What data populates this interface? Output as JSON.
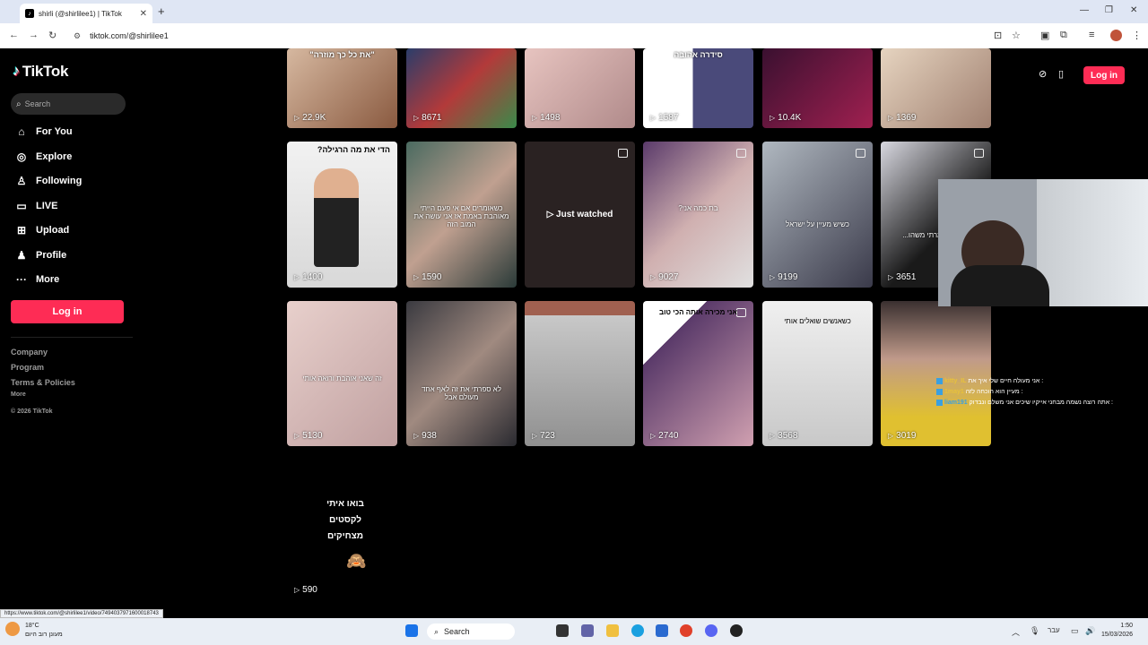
{
  "browser": {
    "tab_title": "shirli (@shirlilee1) | TikTok",
    "tab_close": "✕",
    "new_tab": "+",
    "url": "tiktok.com/@shirlilee1"
  },
  "sidebar": {
    "logo": "TikTok",
    "search_placeholder": "Search",
    "nav": [
      {
        "label": "For You",
        "icon": "home-icon"
      },
      {
        "label": "Explore",
        "icon": "compass-icon"
      },
      {
        "label": "Following",
        "icon": "person-icon"
      },
      {
        "label": "LIVE",
        "icon": "live-icon"
      },
      {
        "label": "Upload",
        "icon": "plus-square-icon"
      },
      {
        "label": "Profile",
        "icon": "profile-icon"
      },
      {
        "label": "More",
        "icon": "more-icon"
      }
    ],
    "login_label": "Log in",
    "footer": {
      "company": "Company",
      "program": "Program",
      "terms": "Terms & Policies",
      "more": "More",
      "copyright": "© 2026 TikTok"
    }
  },
  "header": {
    "login_label": "Log in"
  },
  "videos": {
    "row1": [
      {
        "views": "22.9K",
        "caption": "\"את כל כך מוזרה\""
      },
      {
        "views": "8671",
        "caption": ""
      },
      {
        "views": "1498",
        "caption": ""
      },
      {
        "views": "1587",
        "caption": "סידרה אהובה"
      },
      {
        "views": "10.4K",
        "caption": ""
      },
      {
        "views": "1369",
        "caption": ""
      }
    ],
    "row2": [
      {
        "views": "1400",
        "caption": "הדי את מה הרגילה?"
      },
      {
        "views": "1590",
        "caption": "כשאומרים אם אי פעם הייתי מאוהבת באמת אז אני עושה את המוב הזה"
      },
      {
        "views": "",
        "caption": "",
        "overlay": "Just watched"
      },
      {
        "views": "9027",
        "caption": "בת כמה אני?"
      },
      {
        "views": "9199",
        "caption": "כשיש מעיין על ישראל"
      },
      {
        "views": "3651",
        "caption": "אם אני אמרתי משהו..."
      }
    ],
    "row3": [
      {
        "views": "5130",
        "caption": "זה שאני אוהבת ורואה אותי"
      },
      {
        "views": "938",
        "caption": "לא ספרתי את זה לאף אחד מעולם אבל"
      },
      {
        "views": "723",
        "caption": ""
      },
      {
        "views": "2740",
        "caption": "אני מכירה אותה הכי טוב"
      },
      {
        "views": "3568",
        "caption": "כשאנשים שואלים אותי"
      },
      {
        "views": "3019",
        "caption": ""
      }
    ],
    "row4": [
      {
        "views": "590",
        "caption": "בואו איתי לקסטים מצחיקים"
      }
    ]
  },
  "chat": [
    {
      "user": "kitty_IL",
      "text": "אני מעולה חיים שלי איך את :"
    },
    {
      "user": "1may1",
      "text": "מעיין הוא הוכחה לזה :"
    },
    {
      "user": "liam191",
      "text": "אתה רוצה נשמה מבחני אייקיו שיכים אני משלם ונבדוק :"
    }
  ],
  "status_url": "https://www.tiktok.com/@shirlilee1/video/7494037971600018743",
  "taskbar": {
    "temp": "18°C",
    "weather_text": "מעונן רוב היום",
    "search_label": "Search",
    "lang": "עבר",
    "time": "1:50",
    "date": "15/03/2026"
  }
}
